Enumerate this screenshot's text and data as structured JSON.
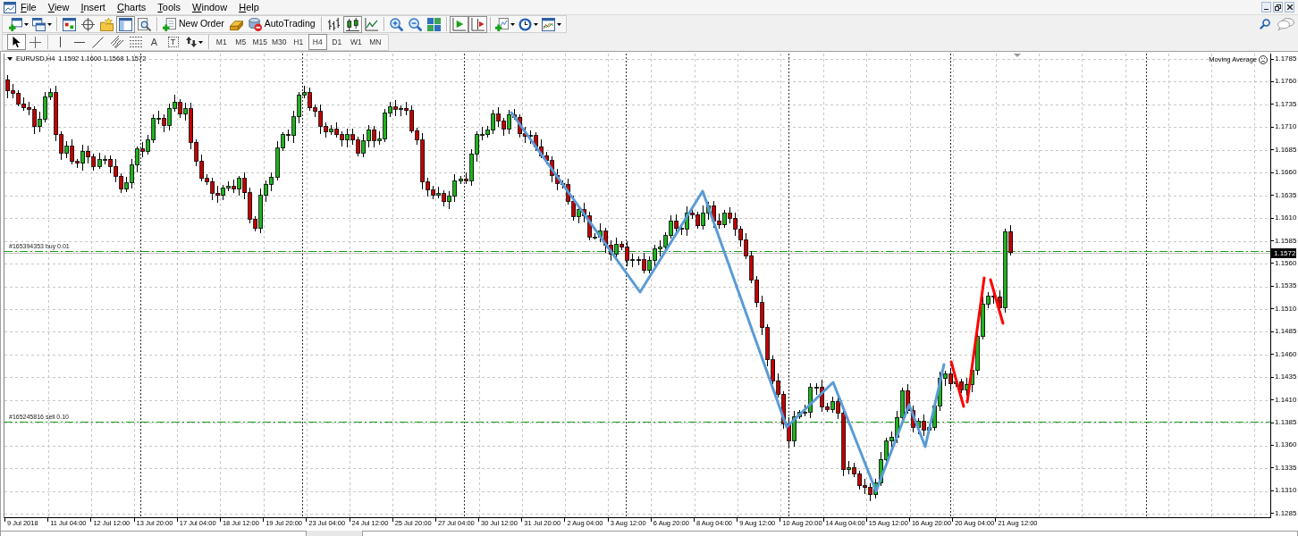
{
  "menu": {
    "items": [
      "File",
      "View",
      "Insert",
      "Charts",
      "Tools",
      "Window",
      "Help"
    ]
  },
  "toolbar": {
    "groups": [
      [
        {
          "kind": "icon",
          "pressed": false
        },
        {
          "kind": "icon",
          "pressed": false
        }
      ],
      [
        {
          "kind": "icon",
          "pressed": false
        },
        {
          "kind": "icon",
          "pressed": false
        },
        {
          "kind": "icon",
          "pressed": false
        },
        {
          "kind": "icon",
          "pressed": true
        },
        {
          "kind": "icon",
          "pressed": false
        }
      ],
      [
        {
          "kind": "button",
          "label": "New Order"
        },
        {
          "kind": "icon",
          "pressed": false
        },
        {
          "kind": "toggle",
          "label": "AutoTrading",
          "on": false
        }
      ],
      [
        {
          "kind": "icon",
          "pressed": false
        },
        {
          "kind": "icon",
          "pressed": true
        },
        {
          "kind": "icon",
          "pressed": false
        }
      ],
      [
        {
          "kind": "icon",
          "pressed": false
        },
        {
          "kind": "icon",
          "pressed": false
        },
        {
          "kind": "icon",
          "pressed": false
        }
      ],
      [
        {
          "kind": "icon",
          "pressed": true
        },
        {
          "kind": "icon",
          "pressed": true
        }
      ],
      [
        {
          "kind": "icon",
          "pressed": false
        },
        {
          "kind": "icon",
          "pressed": false
        },
        {
          "kind": "icon",
          "pressed": false
        }
      ]
    ]
  },
  "drawing_toolbar": {
    "groups": [
      [
        {
          "kind": "icon",
          "pressed": true
        },
        {
          "kind": "icon",
          "pressed": false
        }
      ],
      [
        {
          "kind": "icon",
          "pressed": false
        },
        {
          "kind": "icon",
          "pressed": false
        },
        {
          "kind": "icon",
          "pressed": false
        },
        {
          "kind": "icon",
          "pressed": false
        },
        {
          "kind": "icon",
          "pressed": false
        },
        {
          "kind": "glyph",
          "text": "A",
          "pressed": false
        },
        {
          "kind": "glyph_box",
          "text": "T",
          "pressed": false
        },
        {
          "kind": "icon",
          "pressed": false
        }
      ]
    ]
  },
  "timeframes": [
    {
      "label": "M1",
      "selected": false
    },
    {
      "label": "M5",
      "selected": false
    },
    {
      "label": "M15",
      "selected": false
    },
    {
      "label": "M30",
      "selected": false
    },
    {
      "label": "H1",
      "selected": false
    },
    {
      "label": "H4",
      "selected": true
    },
    {
      "label": "D1",
      "selected": false
    },
    {
      "label": "W1",
      "selected": false
    },
    {
      "label": "MN",
      "selected": false
    }
  ],
  "chart": {
    "symbol": "EURUSD,H4",
    "quote": "1.1592 1.1600 1.1568 1.1572",
    "indicator": "Moving Average",
    "orders": [
      {
        "label": "#165394353 buy 0.01"
      },
      {
        "label": "#165245816 sell 0.10"
      }
    ],
    "price_labels": [
      "1.1785",
      "1.1760",
      "1.1735",
      "1.1710",
      "1.1685",
      "1.1660",
      "1.1635",
      "1.1610",
      "1.1585",
      "1.1560",
      "1.1535",
      "1.1510",
      "1.1485",
      "1.1460",
      "1.1435",
      "1.1410",
      "1.1385",
      "1.1360",
      "1.1335",
      "1.1310",
      "1.1285"
    ],
    "current_price": "1.1572",
    "time_labels": [
      "9 Jul 2018",
      "11 Jul 04:00",
      "12 Jul 12:00",
      "13 Jul 20:00",
      "17 Jul 04:00",
      "18 Jul 12:00",
      "19 Jul 20:00",
      "23 Jul 04:00",
      "24 Jul 12:00",
      "25 Jul 20:00",
      "27 Jul 04:00",
      "30 Jul 12:00",
      "31 Jul 20:00",
      "2 Aug 04:00",
      "3 Aug 12:00",
      "6 Aug 20:00",
      "8 Aug 04:00",
      "9 Aug 12:00",
      "10 Aug 20:00",
      "14 Aug 04:00",
      "15 Aug 12:00",
      "16 Aug 20:00",
      "20 Aug 04:00",
      "21 Aug 12:00"
    ]
  }
}
